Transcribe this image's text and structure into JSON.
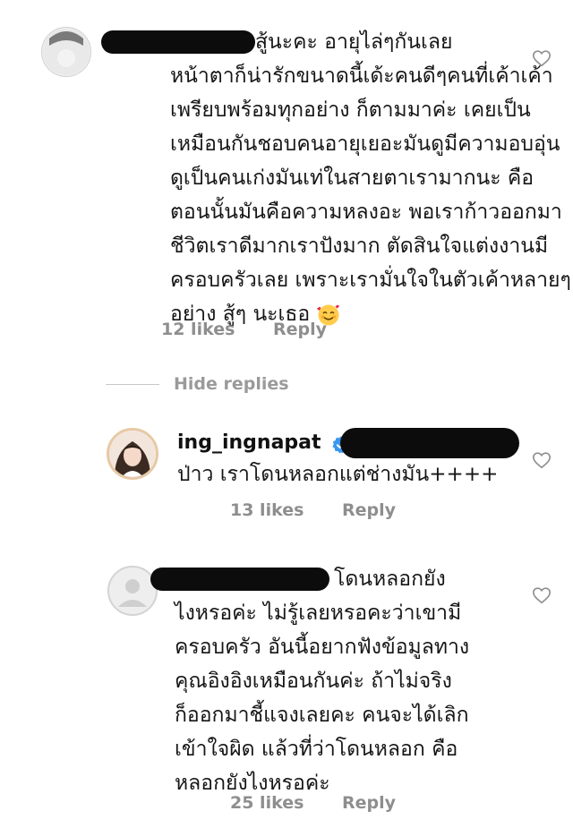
{
  "comments": [
    {
      "lines": [
        "สู้นะคะ อายุไล่ๆกันเลย",
        "หน้าตาก็น่ารักขนาดนี้เด้ะคนดีๆคนที่เค้าเค้า",
        "เพรียบพร้อมทุกอย่าง ก็ตามมาค่ะ เคยเป็น",
        "เหมือนกันชอบคนอายุเยอะมันดูมีความอบอุ่น",
        "ดูเป็นคนเก่งมันเท่ในสายตาเรามากนะ คือ",
        "ตอนนั้นมันคือความหลงอะ พอเราก้าวออกมา",
        "ชีวิตเราดีมากเราปังมาก ตัดสินใจแต่งงานมี",
        "ครอบครัวเลย เพราะเรามั่นใจในตัวเค้าหลายๆ",
        "อย่าง สู้ๆ นะเธอ"
      ],
      "emoji": "smiling-face-with-hearts",
      "likes": "12 likes",
      "reply": "Reply",
      "icon": "heart-outline-icon"
    },
    {
      "username": "ing_ingnapat",
      "verified": true,
      "lines": [
        "ป่าว เราโดนหลอกแต่ช่างมัน++++"
      ],
      "likes": "13 likes",
      "reply": "Reply",
      "icon": "heart-outline-icon"
    },
    {
      "lines": [
        "โดนหลอกยัง",
        "ไงหรอค่ะ ไม่รู้เลยหรอคะว่าเขามี",
        "ครอบครัว อันนี้อยากฟังข้อมูลทาง",
        "คุณอิงอิงเหมือนกันค่ะ ถ้าไม่จริง",
        "ก็ออกมาชี้แจงเลยคะ คนจะได้เลิก",
        "เข้าใจผิด แล้วที่ว่าโดนหลอก คือ",
        "หลอกยังไงหรอค่ะ"
      ],
      "likes": "25 likes",
      "reply": "Reply",
      "icon": "heart-outline-icon"
    }
  ],
  "hide_replies": "Hide replies",
  "colors": {
    "text": "#161616",
    "meta": "#8e8e8e",
    "verified": "#3897f0",
    "redaction": "#0c0c0c"
  }
}
